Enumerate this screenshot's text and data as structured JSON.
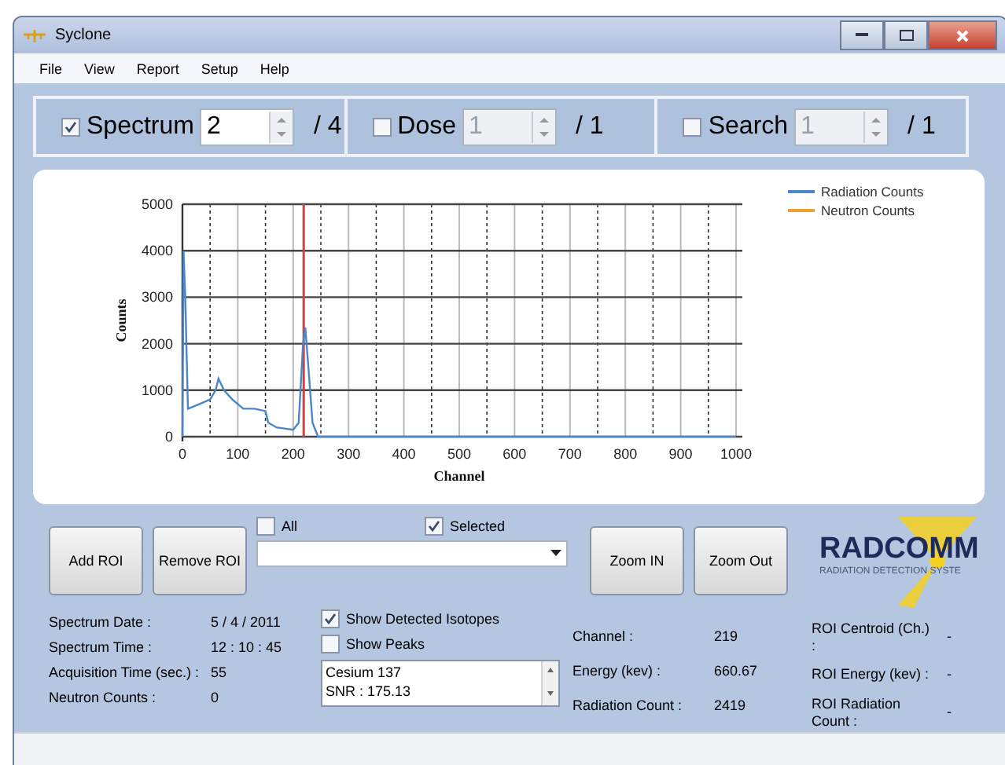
{
  "window": {
    "title": "Syclone"
  },
  "menu": [
    "File",
    "View",
    "Report",
    "Setup",
    "Help"
  ],
  "toolbar": [
    {
      "label": "Spectrum",
      "checked": true,
      "value": "2",
      "disabled": false,
      "total": "/ 4"
    },
    {
      "label": "Dose",
      "checked": false,
      "value": "1",
      "disabled": true,
      "total": "/ 1"
    },
    {
      "label": "Search",
      "checked": false,
      "value": "1",
      "disabled": true,
      "total": "/ 1"
    }
  ],
  "chart": {
    "chart_data": {
      "type": "line",
      "xlabel": "Channel",
      "ylabel": "Counts",
      "x": [
        0,
        2,
        5,
        10,
        20,
        30,
        40,
        50,
        60,
        65,
        75,
        90,
        110,
        130,
        150,
        155,
        170,
        200,
        210,
        218,
        222,
        228,
        235,
        245,
        300,
        1000
      ],
      "series": [
        {
          "name": "Radiation Counts",
          "color": "#4a86c8",
          "values": [
            0,
            4000,
            3000,
            600,
            650,
            700,
            750,
            800,
            1000,
            1250,
            1000,
            800,
            600,
            600,
            550,
            300,
            200,
            150,
            300,
            2000,
            2350,
            1400,
            300,
            0,
            0,
            0
          ]
        },
        {
          "name": "Neutron Counts",
          "color": "#f0a030",
          "values": [
            null,
            null,
            null,
            null,
            null,
            null,
            null,
            null,
            null,
            null,
            null,
            null,
            null,
            null,
            null,
            null,
            null,
            null,
            null,
            null,
            null,
            null,
            null,
            null,
            null,
            null
          ]
        }
      ],
      "xlim": [
        0,
        1000
      ],
      "ylim": [
        0,
        5000
      ],
      "xticks": [
        0,
        100,
        200,
        300,
        400,
        500,
        600,
        700,
        800,
        900,
        1000
      ],
      "yticks": [
        0,
        1000,
        2000,
        3000,
        4000,
        5000
      ],
      "grid": true,
      "legend": true,
      "ref_lines": [
        {
          "axis": "x",
          "value": 219
        }
      ]
    }
  },
  "roi_controls": {
    "buttons": [
      "Add ROI",
      "Remove ROI"
    ],
    "toggles": [
      {
        "label": "All",
        "checked": false
      },
      {
        "label": "Selected",
        "checked": true
      }
    ],
    "zoom_buttons": [
      "Zoom IN",
      "Zoom Out"
    ]
  },
  "logo": {
    "name": "RADCOMM",
    "tagline": "RADIATION DETECTION SYSTE"
  },
  "spectrum_info": [
    {
      "label": "Spectrum Date :",
      "value": "5 / 4 / 2011"
    },
    {
      "label": "Spectrum Time :",
      "value": "12 : 10 : 45"
    },
    {
      "label": "Acquisition Time (sec.) :",
      "value": "55"
    },
    {
      "label": "Neutron Counts :",
      "value": "0"
    }
  ],
  "options": [
    {
      "label": "Show Detected Isotopes",
      "checked": true
    },
    {
      "label": "Show Peaks",
      "checked": false
    }
  ],
  "isotopes": [
    "Cesium 137",
    "SNR : 175.13"
  ],
  "measurements": [
    {
      "label": "Channel :",
      "value": "219"
    },
    {
      "label": "Energy (kev) :",
      "value": "660.67"
    },
    {
      "label": "Radiation Count :",
      "value": "2419"
    }
  ],
  "roi_info": [
    {
      "label": "ROI Centroid (Ch.) :",
      "value": "-"
    },
    {
      "label": "ROI Energy (kev) :",
      "value": "-"
    },
    {
      "label": "ROI Radiation Count :",
      "value": "-"
    }
  ]
}
